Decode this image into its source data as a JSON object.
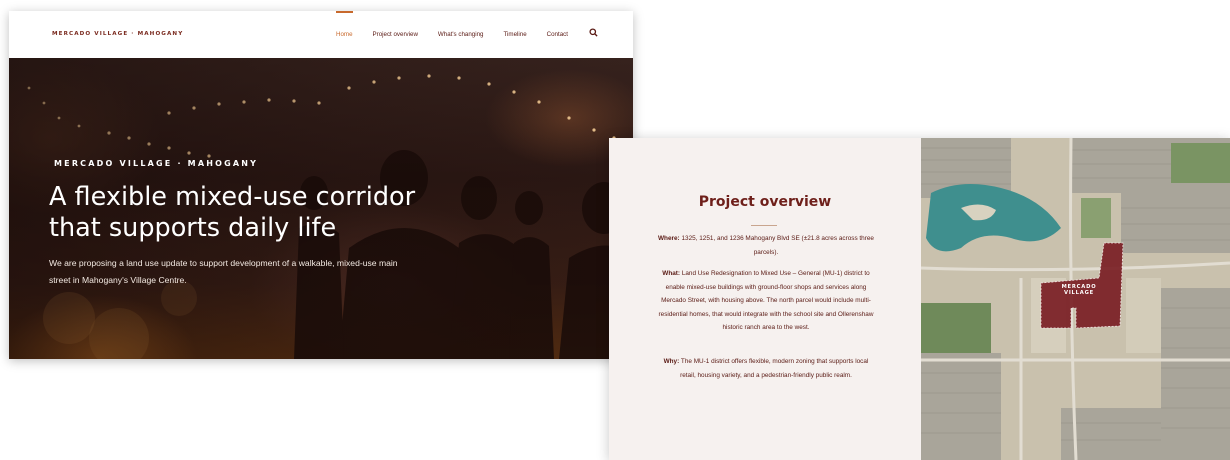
{
  "nav": {
    "brand": "MERCADO VILLAGE · MAHOGANY",
    "links": [
      "Home",
      "Project overview",
      "What's changing",
      "Timeline",
      "Contact"
    ],
    "search_icon": "search-icon",
    "accent": "#c8692c"
  },
  "hero": {
    "kicker": "MERCADO VILLAGE · MAHOGANY",
    "title": "A flexible mixed-use corridor that supports daily life",
    "text": "We are proposing a land use update to support development of a walkable, mixed-use main street in Mahogany's Village Centre."
  },
  "overview": {
    "title": "Project overview",
    "where_label": "Where:",
    "where_text": "1325, 1251, and 1236 Mahogany Blvd SE (±21.8 acres across three parcels).",
    "what_label": "What:",
    "what_text": "Land Use Redesignation to Mixed Use – General (MU-1) district to enable mixed-use buildings with ground-floor shops and services along Mercado Street, with housing above. The north parcel would include multi-residential homes, that would integrate with the school site and Ollerenshaw historic ranch area to the west.",
    "why_label": "Why:",
    "why_text": "The MU-1 district offers flexible, modern zoning that supports local retail, housing variety, and a pedestrian-friendly public realm.",
    "map_label": "MERCADO VILLAGE",
    "site_color": "#7a1e24"
  }
}
